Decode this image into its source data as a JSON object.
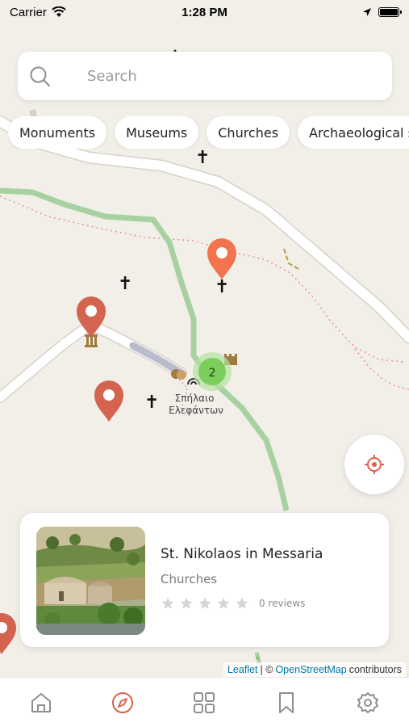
{
  "status_bar": {
    "carrier": "Carrier",
    "time": "1:28 PM",
    "icons": [
      "wifi-icon",
      "location-arrow-icon",
      "battery-icon"
    ]
  },
  "search": {
    "placeholder": "Search",
    "icon": "search-icon"
  },
  "categories": [
    {
      "label": "Monuments"
    },
    {
      "label": "Museums"
    },
    {
      "label": "Churches"
    },
    {
      "label": "Archaeological si"
    }
  ],
  "map": {
    "place_label_line1": "Σπήλαιο",
    "place_label_line2": "Ελεφάντων",
    "cluster_count": "2",
    "pin_color": "#d4644f",
    "selected_pin_color": "#f2744f",
    "cluster_color": "#7ccd5c",
    "attribution": {
      "leaflet": "Leaflet",
      "separator": "| ©",
      "osm": "OpenStreetMap",
      "suffix": "contributors"
    }
  },
  "locate_button": {
    "icon": "crosshair-icon",
    "color": "#d4644f"
  },
  "place_card": {
    "title": "St. Nikolaos in Messaria",
    "category": "Churches",
    "rating": 0,
    "reviews": "0 reviews"
  },
  "tab_bar": {
    "tabs": [
      {
        "icon": "home-icon",
        "active": false
      },
      {
        "icon": "compass-icon",
        "active": true
      },
      {
        "icon": "grid-icon",
        "active": false
      },
      {
        "icon": "bookmark-icon",
        "active": false
      },
      {
        "icon": "gear-icon",
        "active": false
      }
    ],
    "active_color": "#d4644f",
    "inactive_color": "#8e8e93"
  }
}
